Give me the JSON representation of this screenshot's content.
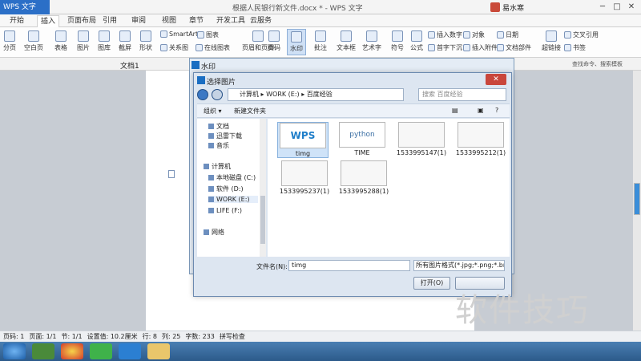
{
  "app": {
    "brand": "WPS 文字",
    "window_title": "根据人民银行新文件.docx * - WPS 文字",
    "user": "易水寒"
  },
  "tabs": [
    "开始",
    "插入",
    "页面布局",
    "引用",
    "审阅",
    "视图",
    "章节",
    "开发工具",
    "云服务"
  ],
  "active_tab": "插入",
  "ribbon": {
    "large": [
      "分页",
      "空白页",
      "表格",
      "图片",
      "图库",
      "截屏",
      "形状",
      "页眉和页脚",
      "页码",
      "水印",
      "批注",
      "文本框",
      "艺术字",
      "符号",
      "公式",
      "超链接",
      "书签"
    ],
    "small": [
      "SmartArt",
      "图表",
      "关系图",
      "在线图表",
      "插入数字",
      "对象",
      "日期",
      "首字下沉",
      "插入附件",
      "文档部件",
      "交叉引用"
    ]
  },
  "qbar": {
    "doc_tab": "文档1",
    "search": "查找命令、搜索模板"
  },
  "watermark_dialog": {
    "title": "水印"
  },
  "file_dialog": {
    "title": "选择图片",
    "path": [
      "计算机",
      "WORK (E:)",
      "百度经验"
    ],
    "search_placeholder": "搜索 百度经验",
    "organize": "组织 ▾",
    "new_folder": "新建文件夹",
    "nav": {
      "favorites": [
        "文档",
        "迅雷下载",
        "音乐"
      ],
      "computer": "计算机",
      "drives": [
        "本地磁盘 (C:)",
        "软件 (D:)",
        "WORK (E:)",
        "LIFE (F:)"
      ],
      "network": "网络"
    },
    "files": [
      "timg",
      "TIME",
      "1533995147(1)",
      "1533995212(1)",
      "1533995237(1)",
      "1533995288(1)"
    ],
    "selected_file": "timg",
    "thumb_texts": {
      "wps": "WPS",
      "python": "python"
    },
    "filename_label": "文件名(N):",
    "filename_value": "timg",
    "filetype_value": "所有图片格式(*.jpg;*.png;*.bmp",
    "open_button": "打开(O)"
  },
  "status": [
    "页码: 1",
    "页面: 1/1",
    "节: 1/1",
    "设置值: 10.2厘米",
    "行: 8",
    "列: 25",
    "字数: 233",
    "拼写检查"
  ],
  "watermark_text": "软件技巧"
}
